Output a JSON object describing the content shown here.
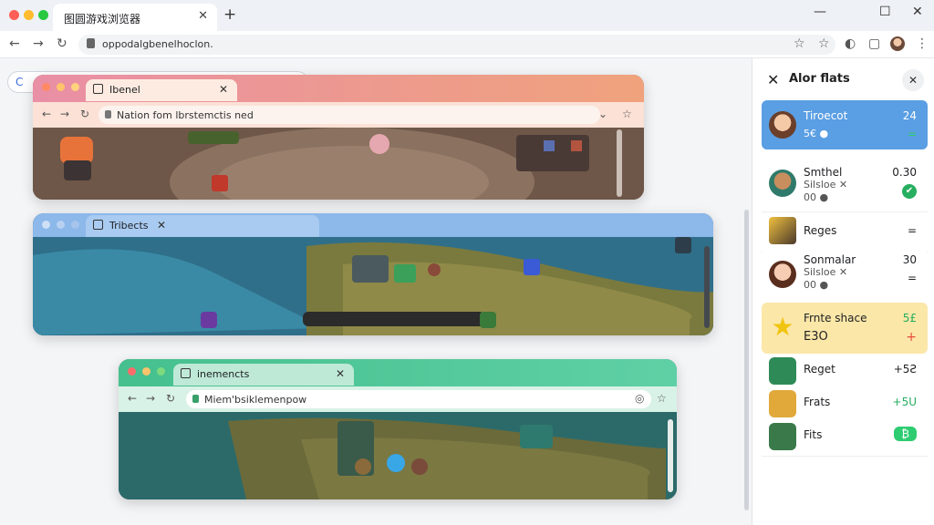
{
  "browser": {
    "tab_title": "图圆游戏浏览器",
    "tab_close": "✕",
    "new_tab": "+",
    "url": "oppodalgbenelhoclon.",
    "window_controls": [
      "—",
      "☐",
      "✕"
    ],
    "nav": {
      "back": "←",
      "forward": "→",
      "reload": "↻"
    },
    "toolbar_icons": [
      "☆",
      "☆",
      "◐",
      "▢",
      "⋮"
    ]
  },
  "pill_glyph": "C",
  "windows": [
    {
      "tab_title": "Ibenel",
      "url": "Nation fom lbrstemctis ned",
      "nav": [
        "←",
        "→",
        "↻"
      ],
      "right_icons": [
        "⌄",
        "☆"
      ],
      "colors": {
        "head": "#f0a27c",
        "bar": "#fbe1d6",
        "tab": "#fdebe1"
      }
    },
    {
      "tab_title": "Tribects",
      "colors": {
        "head": "#8cb8ea",
        "tab": "#a9cbf1"
      }
    },
    {
      "tab_title": "inemencts",
      "url": "Miem'bsiklemenpow",
      "nav": [
        "←",
        "→",
        "↻"
      ],
      "right_icons": [
        "◎",
        "☆"
      ],
      "colors": {
        "head": "#52c69b",
        "bar": "#d9f2e7",
        "tab": "#bfe9d7"
      }
    }
  ],
  "sidebar": {
    "close_glyph": "✕",
    "title": "Alor flats",
    "dismiss_glyph": "✕",
    "items": [
      {
        "name": "Tiroecot",
        "sub": "5€ ●",
        "value": "24",
        "indicator": "=",
        "bg": "#5a9ee3",
        "text_color": "#ffffff"
      },
      {
        "name": "Smthel",
        "sub": "Silsloe ✕",
        "sub2": "00 ●",
        "value": "0.30",
        "indicator": "✔",
        "bg": "#ffffff",
        "text_color": "#222222"
      },
      {
        "name": "Reges",
        "value": "",
        "indicator": "=",
        "bg": "#ffffff",
        "text_color": "#222222"
      },
      {
        "name": "Sonmalar",
        "sub": "Silsloe ✕",
        "sub2": "00 ●",
        "value": "30",
        "indicator": "=",
        "bg": "#ffffff",
        "text_color": "#222222"
      },
      {
        "name": "Frnte shace",
        "sub": "E3O",
        "value": "5£",
        "indicator": "+",
        "bg": "#fbe7a8",
        "text_color": "#222222"
      },
      {
        "name": "Reget",
        "value": "+5Ƨ",
        "bg": "#ffffff",
        "text_color": "#222222"
      },
      {
        "name": "Frats",
        "value": "+5U",
        "bg": "#ffffff",
        "text_color": "#222222"
      },
      {
        "name": "Fits",
        "value": "₿",
        "bg": "#ffffff",
        "text_color": "#222222"
      }
    ]
  }
}
